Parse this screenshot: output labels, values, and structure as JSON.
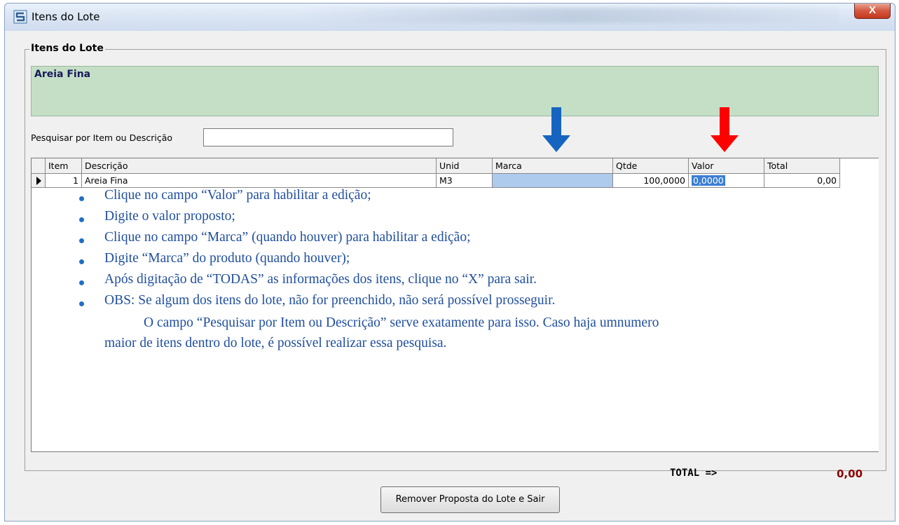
{
  "window": {
    "title": "Itens do Lote",
    "close_label": "X"
  },
  "group": {
    "legend": "Itens do Lote",
    "selected_description": "Areia Fina"
  },
  "search": {
    "label": "Pesquisar por Item ou Descrição",
    "value": ""
  },
  "grid": {
    "columns": [
      "Item",
      "Descrição",
      "Unid",
      "Marca",
      "Qtde",
      "Valor",
      "Total"
    ],
    "rows": [
      {
        "item": "1",
        "descricao": "Areia Fina",
        "unid": "M3",
        "marca": "",
        "qtde": "100,0000",
        "valor": "0,0000",
        "total": "0,00"
      }
    ]
  },
  "arrows": {
    "marca_color": "#1565c0",
    "valor_color": "#ff0000"
  },
  "instructions": {
    "bullets": [
      "Clique no campo “Valor” para habilitar a edição;",
      "Digite o valor proposto;",
      "Clique no campo “Marca” (quando houver) para habilitar a edição;",
      "Digite “Marca” do produto (quando houver);",
      "Após digitação de “TODAS” as informações dos itens, clique no “X” para sair.",
      "OBS: Se algum dos itens do lote, não for preenchido, não será possível prosseguir."
    ],
    "paragraph_line1": "O campo “Pesquisar por Item ou Descrição” serve exatamente para isso. Caso haja umnumero",
    "paragraph_line2": "maior de itens dentro do lote, é possível realizar essa pesquisa."
  },
  "totals": {
    "label": "TOTAL =>",
    "value": "0,00"
  },
  "buttons": {
    "remove_label": "Remover Proposta do Lote e Sair"
  }
}
